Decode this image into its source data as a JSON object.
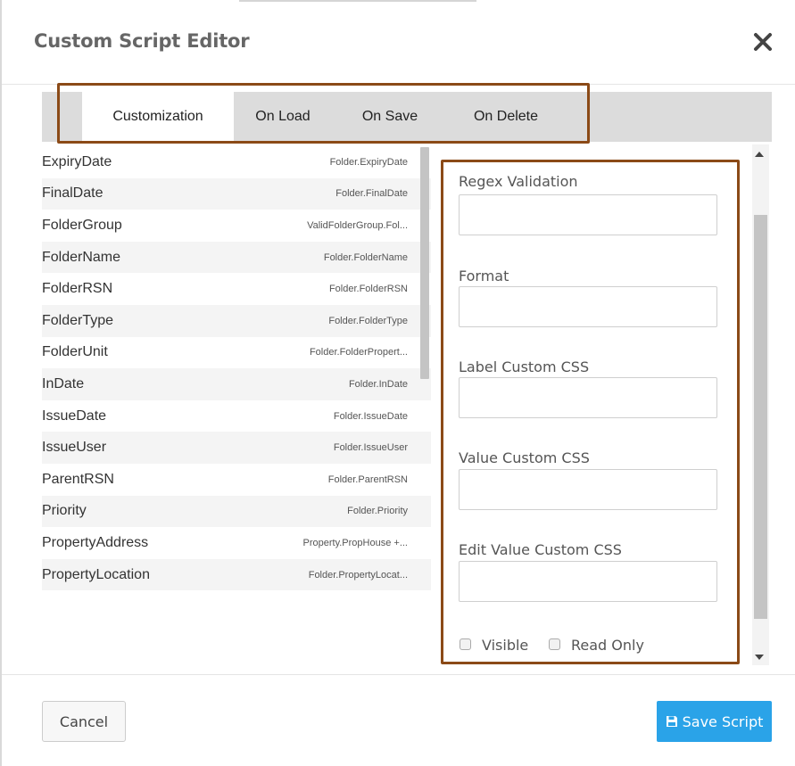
{
  "dialog": {
    "title": "Custom Script Editor",
    "close_icon": "close-icon"
  },
  "tabs": [
    {
      "label": "Customization",
      "active": true
    },
    {
      "label": "On Load",
      "active": false
    },
    {
      "label": "On Save",
      "active": false
    },
    {
      "label": "On Delete",
      "active": false
    }
  ],
  "fields_list": [
    {
      "name": "ExpiryDate",
      "path": "Folder.ExpiryDate"
    },
    {
      "name": "FinalDate",
      "path": "Folder.FinalDate"
    },
    {
      "name": "FolderGroup",
      "path": "ValidFolderGroup.Fol..."
    },
    {
      "name": "FolderName",
      "path": "Folder.FolderName"
    },
    {
      "name": "FolderRSN",
      "path": "Folder.FolderRSN"
    },
    {
      "name": "FolderType",
      "path": "Folder.FolderType"
    },
    {
      "name": "FolderUnit",
      "path": "Folder.FolderPropert..."
    },
    {
      "name": "InDate",
      "path": "Folder.InDate"
    },
    {
      "name": "IssueDate",
      "path": "Folder.IssueDate"
    },
    {
      "name": "IssueUser",
      "path": "Folder.IssueUser"
    },
    {
      "name": "ParentRSN",
      "path": "Folder.ParentRSN"
    },
    {
      "name": "Priority",
      "path": "Folder.Priority"
    },
    {
      "name": "PropertyAddress",
      "path": "Property.PropHouse +..."
    },
    {
      "name": "PropertyLocation",
      "path": "Folder.PropertyLocat..."
    }
  ],
  "panel": {
    "regex_label": "Regex Validation",
    "regex_value": "",
    "format_label": "Format",
    "format_value": "",
    "label_css_label": "Label Custom CSS",
    "label_css_value": "",
    "value_css_label": "Value Custom CSS",
    "value_css_value": "",
    "edit_value_css_label": "Edit Value Custom CSS",
    "edit_value_css_value": "",
    "visible_label": "Visible",
    "visible_checked": false,
    "readonly_label": "Read Only",
    "readonly_checked": false
  },
  "footer": {
    "cancel_label": "Cancel",
    "save_label": "Save Script",
    "save_icon": "floppy-disk-icon"
  },
  "colors": {
    "highlight": "#8b4a17",
    "primary": "#2aa3e8"
  }
}
